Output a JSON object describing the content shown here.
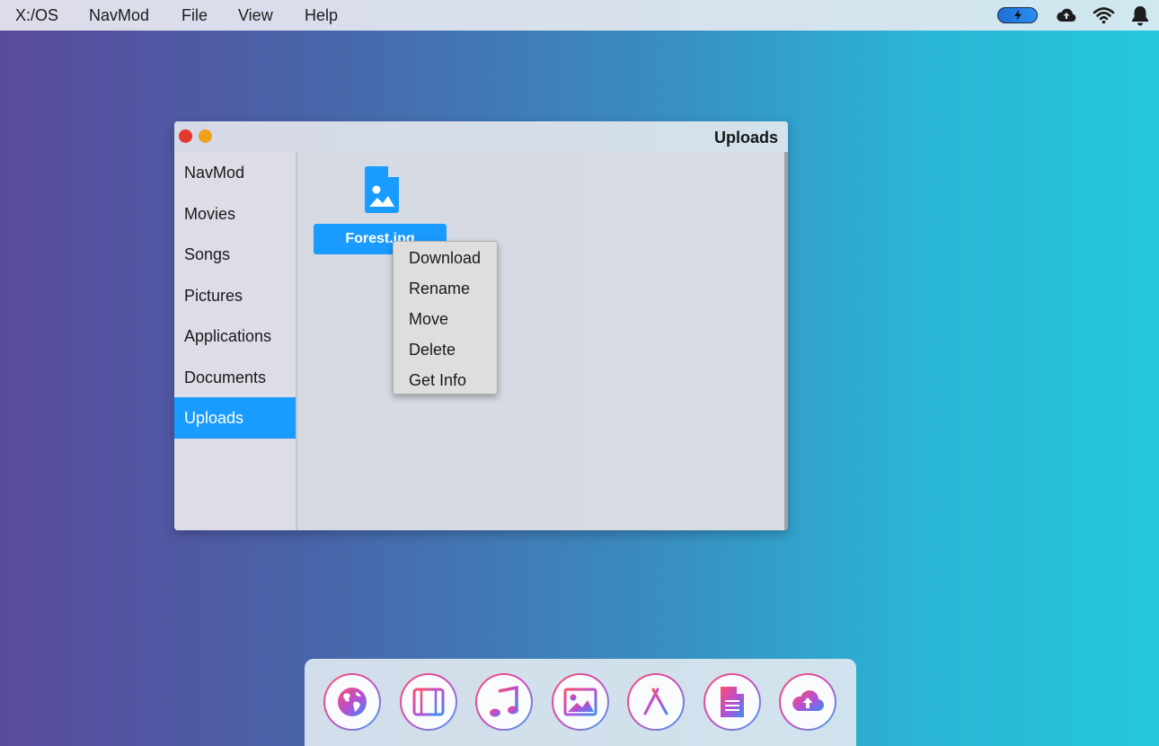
{
  "menubar": {
    "items": [
      "X:/OS",
      "NavMod",
      "File",
      "View",
      "Help"
    ],
    "battery_icon": "bolt-icon",
    "icons": [
      "cloud-upload-icon",
      "wifi-icon",
      "bell-icon"
    ]
  },
  "window": {
    "title": "Uploads",
    "sidebar": {
      "items": [
        "NavMod",
        "Movies",
        "Songs",
        "Pictures",
        "Applications",
        "Documents",
        "Uploads"
      ],
      "active": "Uploads"
    },
    "files": [
      {
        "name": "Forest.jpg",
        "icon": "image-file-icon",
        "selected": true
      }
    ]
  },
  "context_menu": {
    "items": [
      "Download",
      "Rename",
      "Move",
      "Delete",
      "Get Info"
    ]
  },
  "dock": {
    "items": [
      "globe-icon",
      "film-icon",
      "music-icon",
      "picture-icon",
      "app-store-icon",
      "document-icon",
      "cloud-upload-icon"
    ]
  },
  "colors": {
    "accent": "#1a9bff",
    "close": "#e33a2e",
    "minimize": "#efa11c"
  }
}
